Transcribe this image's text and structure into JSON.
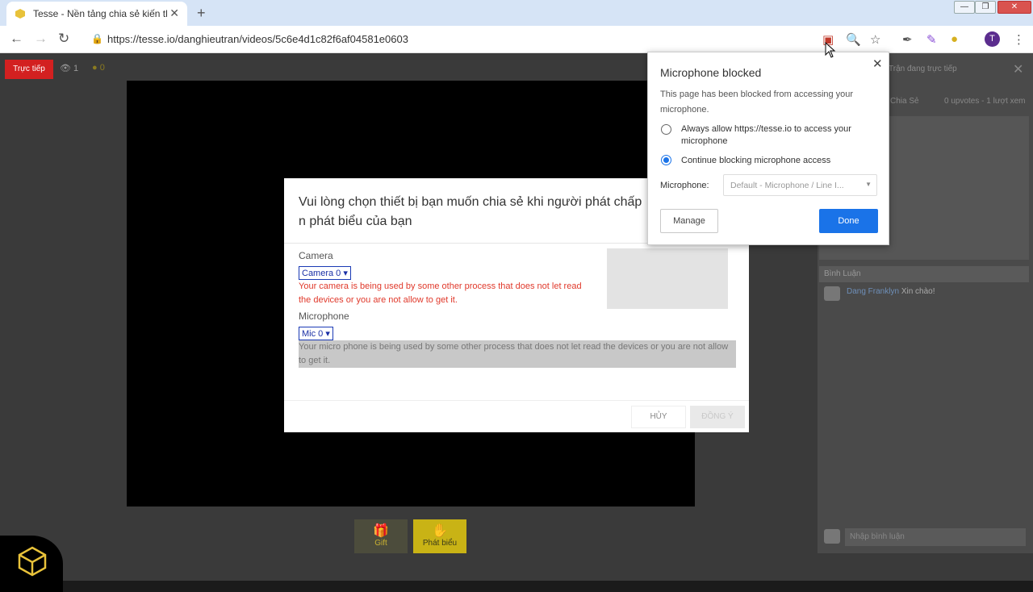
{
  "browser": {
    "tab_title": "Tesse - Nền tảng chia sẻ kiến thứ",
    "url": "https://tesse.io/danghieutran/videos/5c6e4d1c82f6af04581e0603",
    "avatar_letter": "T"
  },
  "page": {
    "live_label": "Trực tiếp",
    "viewer_count": "1",
    "coin_count": "0",
    "gift_label": "Gift",
    "speak_label": "Phát biểu",
    "right_panel": {
      "title": "Trận đang trực tiếp",
      "share": "Chia Sẻ",
      "stats": "0 upvotes - 1 lượt xem",
      "comments_header": "Bình Luận",
      "comment_author": "Dang Franklyn",
      "comment_text": "Xin chào!",
      "comment_placeholder": "Nhập bình luận"
    }
  },
  "dialog": {
    "title": "Vui lòng chọn thiết bị bạn muốn chia sẻ khi người phát chấp n phát biểu của bạn",
    "camera_label": "Camera",
    "camera_select": "Camera 0",
    "camera_error": "Your camera is being used by some other process that does not let read the devices or you are not allow to get it.",
    "mic_label": "Microphone",
    "mic_select": "Mic 0",
    "mic_error": "Your micro phone is being used by some other process that does not let read the devices or you are not allow to get it.",
    "cancel": "HỦY",
    "accept": "ĐỒNG Ý"
  },
  "mic_popup": {
    "title": "Microphone blocked",
    "description": "This page has been blocked from accessing your microphone.",
    "option_allow": "Always allow https://tesse.io to access your microphone",
    "option_block": "Continue blocking microphone access",
    "selected_option": "block",
    "mic_label": "Microphone:",
    "mic_value": "Default - Microphone / Line I...",
    "manage": "Manage",
    "done": "Done"
  },
  "colors": {
    "accent": "#1a73e8",
    "live_red": "#d32020",
    "speak_yellow": "#c9b315",
    "error_red": "#e0392b"
  }
}
